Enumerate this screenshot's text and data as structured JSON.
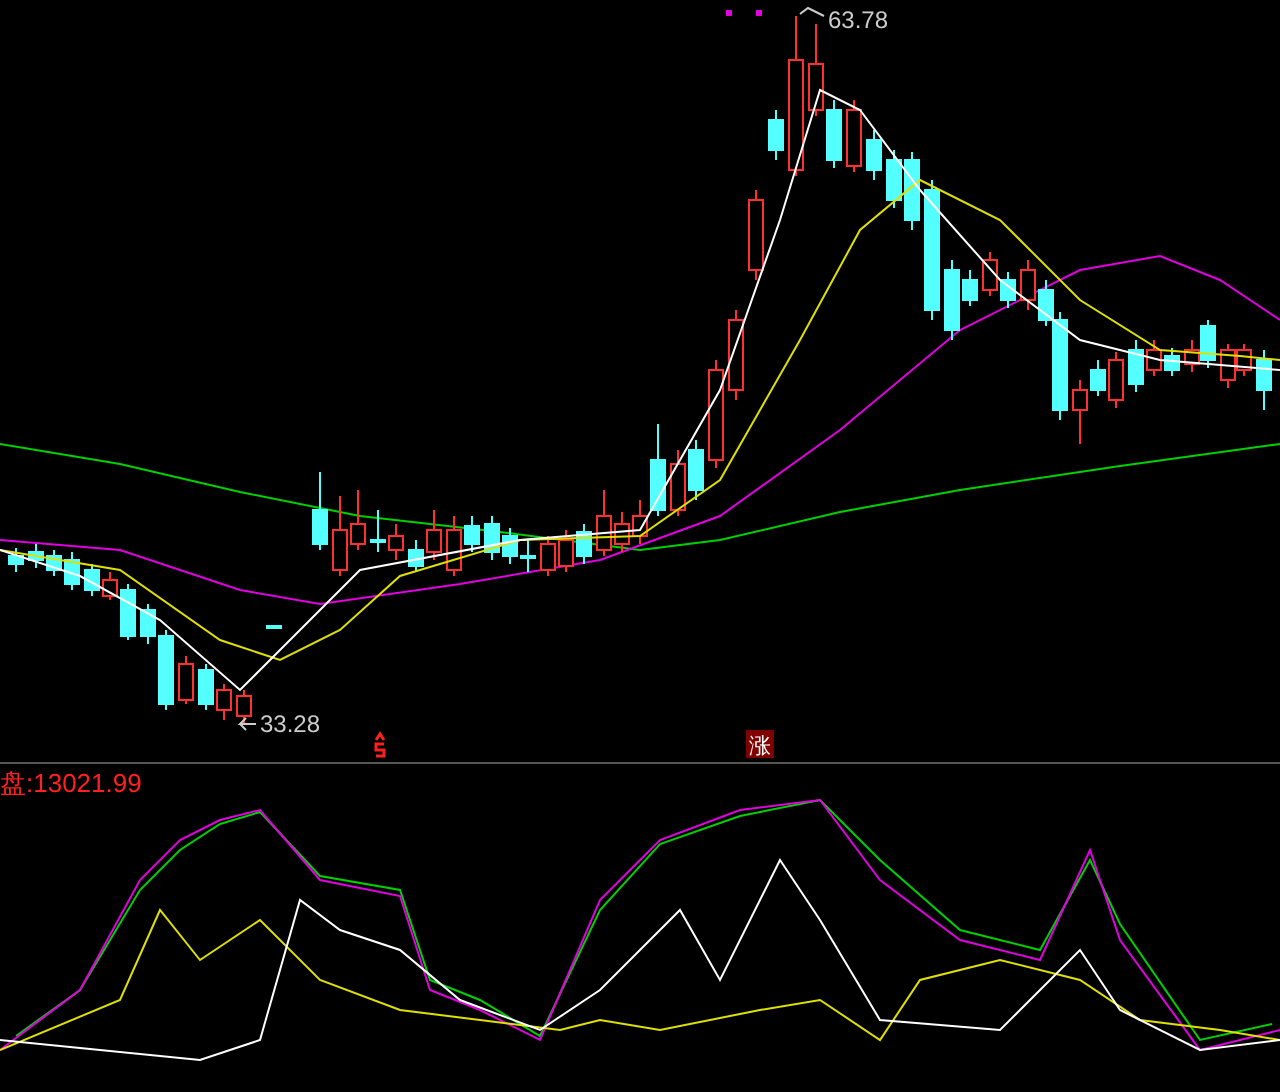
{
  "price_chart": {
    "high_label": "63.78",
    "low_label": "33.28",
    "signal_badge": "涨"
  },
  "indicator_panel": {
    "label": "盘:13021.99"
  }
}
